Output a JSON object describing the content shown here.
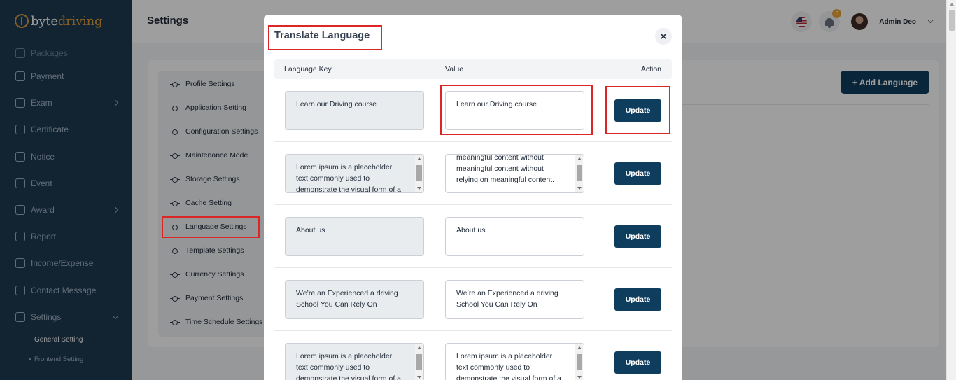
{
  "brand": {
    "part1": "byte",
    "part2": "driving"
  },
  "sidebar": {
    "items": [
      {
        "label": "Packages"
      },
      {
        "label": "Payment"
      },
      {
        "label": "Exam"
      },
      {
        "label": "Certificate"
      },
      {
        "label": "Notice"
      },
      {
        "label": "Event"
      },
      {
        "label": "Award"
      },
      {
        "label": "Report"
      },
      {
        "label": "Income/Expense"
      },
      {
        "label": "Contact Message"
      },
      {
        "label": "Settings"
      }
    ],
    "sub_items": [
      {
        "label": "General Setting"
      },
      {
        "label": "Frontend Setting"
      }
    ]
  },
  "header": {
    "title": "Settings",
    "notification_count": "0",
    "user_name": "Admin Deo"
  },
  "settings_menu": {
    "items": [
      {
        "label": "Profile Settings"
      },
      {
        "label": "Application Setting"
      },
      {
        "label": "Configuration Settings"
      },
      {
        "label": "Maintenance Mode"
      },
      {
        "label": "Storage Settings"
      },
      {
        "label": "Cache Setting"
      },
      {
        "label": "Language Settings"
      },
      {
        "label": "Template Settings"
      },
      {
        "label": "Currency Settings"
      },
      {
        "label": "Payment Settings"
      },
      {
        "label": "Time Schedule Settings"
      }
    ]
  },
  "add_language_label": "+ Add Language",
  "modal": {
    "title": "Translate Language",
    "close_symbol": "×",
    "columns": {
      "key": "Language Key",
      "value": "Value",
      "action": "Action"
    },
    "update_label": "Update",
    "rows": [
      {
        "key": "Learn our Driving course",
        "value": "Learn our Driving course"
      },
      {
        "key": "Lorem ipsum is a placeholder text commonly used to demonstrate the visual form of a document or",
        "value": "meaningful content without meaningful content without relying on meaningful content."
      },
      {
        "key": "About us",
        "value": "About us"
      },
      {
        "key": "We’re an Experienced a driving School You Can Rely On",
        "value": "We’re an Experienced a driving School You Can Rely On"
      },
      {
        "key": "Lorem ipsum is a placeholder text commonly used to demonstrate the visual form of a document or",
        "value": "Lorem ipsum is a placeholder text commonly used to demonstrate the visual form of a document or"
      }
    ]
  },
  "colors": {
    "sidebar_bg": "#1e3a52",
    "primary_button": "#0f3d5e",
    "brand_accent": "#d99a3a",
    "highlight_red": "#dc2626"
  }
}
